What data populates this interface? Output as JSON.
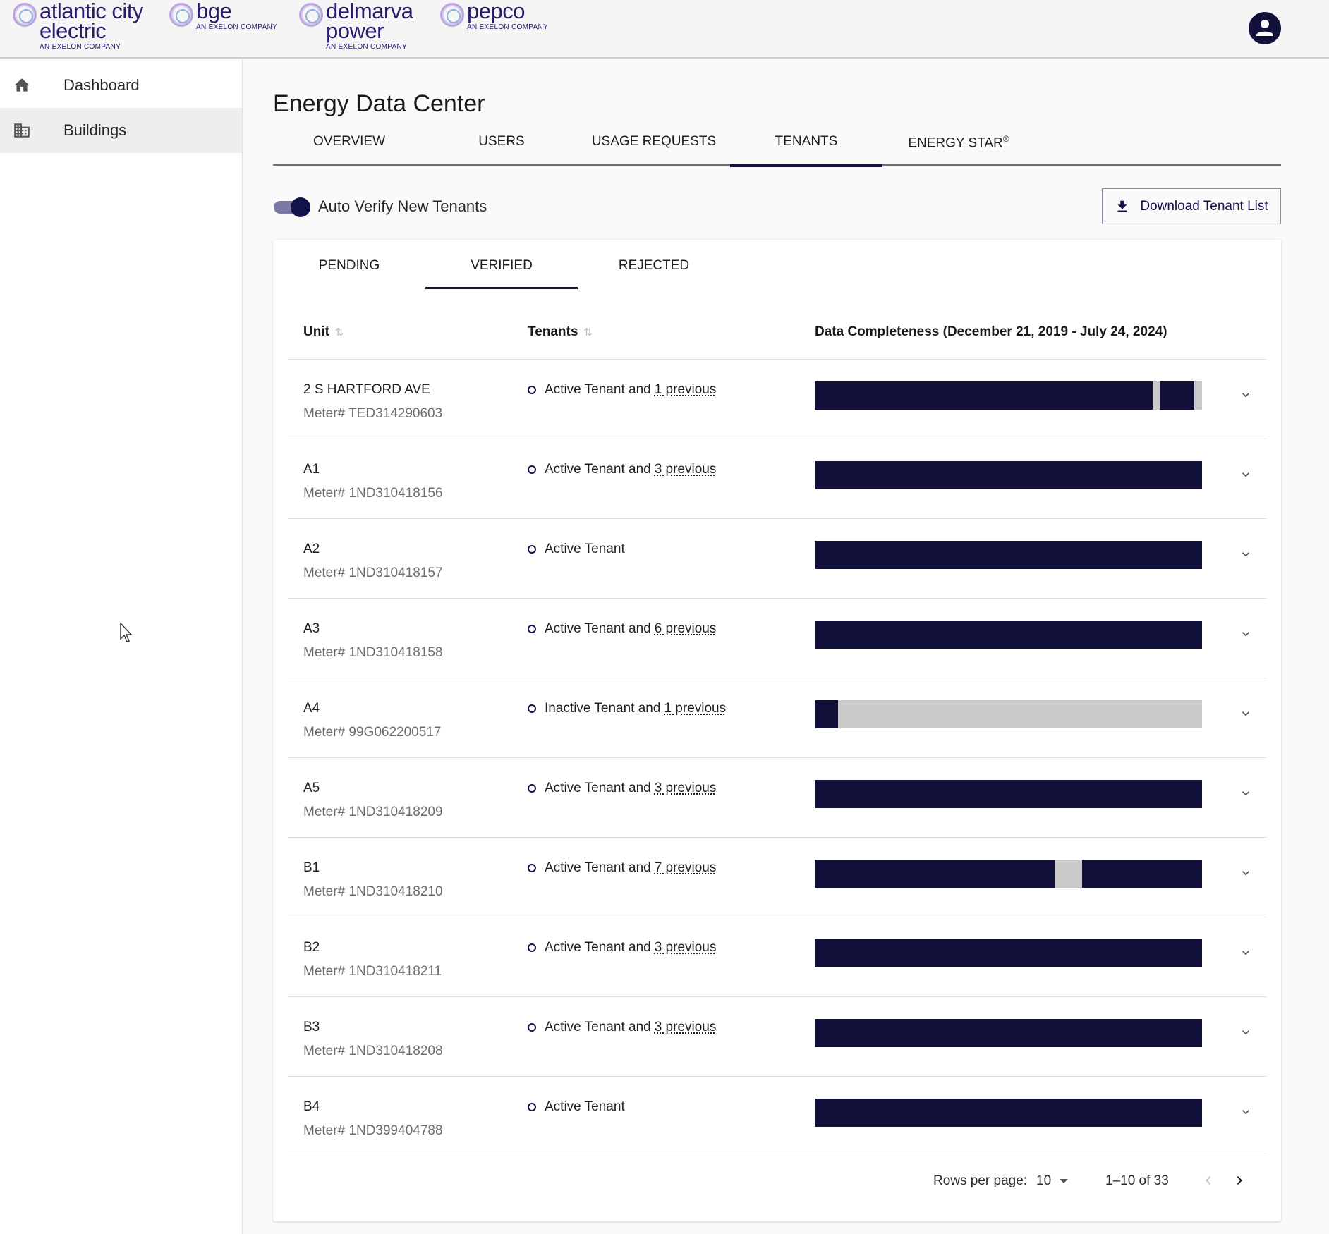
{
  "brands": [
    {
      "name": "atlantic city\nelectric",
      "tagline": "AN EXELON COMPANY"
    },
    {
      "name": "bge",
      "tagline": "AN EXELON COMPANY"
    },
    {
      "name": "delmarva\npower",
      "tagline": "AN EXELON COMPANY"
    },
    {
      "name": "pepco",
      "tagline": "AN EXELON COMPANY"
    }
  ],
  "sidebar": {
    "items": [
      {
        "label": "Dashboard",
        "icon": "home-icon",
        "active": false
      },
      {
        "label": "Buildings",
        "icon": "building-icon",
        "active": true
      }
    ]
  },
  "page": {
    "title": "Energy Data Center",
    "tabs": [
      {
        "label": "OVERVIEW"
      },
      {
        "label": "USERS"
      },
      {
        "label": "USAGE REQUESTS"
      },
      {
        "label": "TENANTS",
        "active": true
      },
      {
        "label": "ENERGY STAR",
        "sup": "®"
      }
    ],
    "auto_verify_label": "Auto Verify New Tenants",
    "auto_verify_on": true,
    "download_label": "Download Tenant List"
  },
  "card": {
    "subtabs": [
      {
        "label": "PENDING"
      },
      {
        "label": "VERIFIED",
        "active": true
      },
      {
        "label": "REJECTED"
      }
    ],
    "columns": {
      "unit": "Unit",
      "tenants": "Tenants",
      "completeness": "Data Completeness (December 21, 2019 - July 24, 2024)"
    },
    "rows": [
      {
        "unit": "2 S HARTFORD AVE",
        "meter": "Meter# TED314290603",
        "status": "Active Tenant and",
        "previous": "1 previous",
        "segments": [
          [
            0,
            0.872
          ],
          [
            0.89,
            0.98
          ]
        ]
      },
      {
        "unit": "A1",
        "meter": "Meter# 1ND310418156",
        "status": "Active Tenant and",
        "previous": "3 previous",
        "segments": [
          [
            0,
            1
          ]
        ]
      },
      {
        "unit": "A2",
        "meter": "Meter# 1ND310418157",
        "status": "Active Tenant",
        "previous": "",
        "segments": [
          [
            0,
            1
          ]
        ]
      },
      {
        "unit": "A3",
        "meter": "Meter# 1ND310418158",
        "status": "Active Tenant and",
        "previous": "6 previous",
        "segments": [
          [
            0,
            1
          ]
        ]
      },
      {
        "unit": "A4",
        "meter": "Meter# 99G062200517",
        "status": "Inactive Tenant and",
        "previous": "1 previous",
        "segments": [
          [
            0,
            0.06
          ]
        ]
      },
      {
        "unit": "A5",
        "meter": "Meter# 1ND310418209",
        "status": "Active Tenant and",
        "previous": "3 previous",
        "segments": [
          [
            0,
            1
          ]
        ]
      },
      {
        "unit": "B1",
        "meter": "Meter# 1ND310418210",
        "status": "Active Tenant and",
        "previous": "7 previous",
        "segments": [
          [
            0,
            0.622
          ],
          [
            0.69,
            1
          ]
        ]
      },
      {
        "unit": "B2",
        "meter": "Meter# 1ND310418211",
        "status": "Active Tenant and",
        "previous": "3 previous",
        "segments": [
          [
            0,
            1
          ]
        ]
      },
      {
        "unit": "B3",
        "meter": "Meter# 1ND310418208",
        "status": "Active Tenant and",
        "previous": "3 previous",
        "segments": [
          [
            0,
            1
          ]
        ]
      },
      {
        "unit": "B4",
        "meter": "Meter# 1ND399404788",
        "status": "Active Tenant",
        "previous": "",
        "segments": [
          [
            0,
            1
          ]
        ]
      }
    ],
    "pagination": {
      "rows_per_page_label": "Rows per page:",
      "rows_per_page": "10",
      "range": "1–10 of 33"
    }
  },
  "colors": {
    "brand_navy": "#14124a",
    "bar_filled": "#10103a",
    "bar_empty": "#cacaca"
  }
}
